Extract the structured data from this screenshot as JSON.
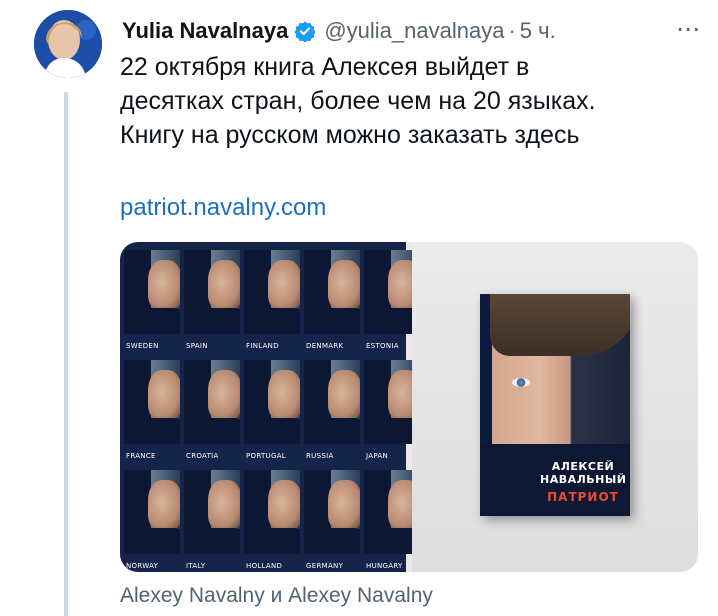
{
  "tweet": {
    "author_name": "Yulia Navalnaya",
    "handle": "@yulia_navalnaya",
    "separator": "·",
    "time": "5 ч.",
    "more_icon": "⋯",
    "text_lines": [
      "22 октября книга Алексея выйдет в",
      "десятках стран, более чем на 20 языках.",
      "Книгу на русском можно заказать здесь"
    ],
    "link": "patriot.navalny.com",
    "media_caption": "Alexey Navalny и Alexey Navalny"
  },
  "media": {
    "left_image": {
      "rows": [
        [
          "SWEDEN",
          "SPAIN",
          "FINLAND",
          "DENMARK",
          "ESTONIA"
        ],
        [
          "FRANCE",
          "CROATIA",
          "PORTUGAL",
          "RUSSIA",
          "JAPAN"
        ],
        [
          "NORWAY",
          "ITALY",
          "HOLLAND",
          "GERMANY",
          "HUNGARY"
        ]
      ]
    },
    "right_image": {
      "book_author_line1": "АЛЕКСЕЙ",
      "book_author_line2": "НАВАЛЬНЫЙ",
      "book_title": "ПАТРИОТ"
    }
  },
  "colors": {
    "link": "#1d6fbf",
    "verified": "#1d9bf0",
    "secondary_text": "#536471"
  }
}
